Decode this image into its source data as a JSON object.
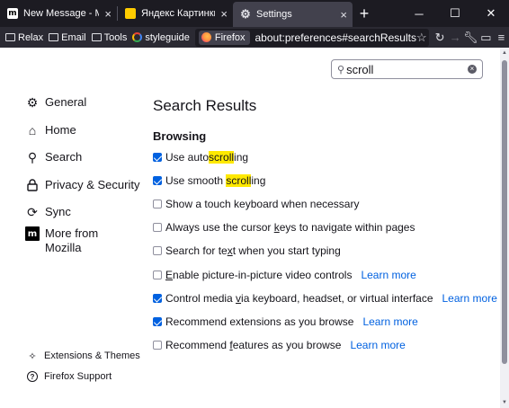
{
  "tabs": [
    {
      "label": "New Message - Mozilla C",
      "favicon": "mozilla-m-icon",
      "active": false
    },
    {
      "label": "Яндекс Картинки: поис",
      "favicon": "yandex-icon",
      "active": false
    },
    {
      "label": "Settings",
      "favicon": "gear-icon",
      "active": true
    }
  ],
  "bookmarks": [
    {
      "label": "Relax",
      "icon": "folder-icon"
    },
    {
      "label": "Email",
      "icon": "folder-icon"
    },
    {
      "label": "Tools",
      "icon": "folder-icon"
    },
    {
      "label": "styleguide",
      "icon": "google-icon"
    }
  ],
  "urlbar": {
    "identity": "Firefox",
    "url": "about:preferences#searchResults"
  },
  "search": {
    "value": "scroll"
  },
  "sidebar": {
    "items": [
      {
        "label": "General",
        "icon": "gear-icon"
      },
      {
        "label": "Home",
        "icon": "home-icon"
      },
      {
        "label": "Search",
        "icon": "search-icon"
      },
      {
        "label": "Privacy & Security",
        "icon": "lock-icon"
      },
      {
        "label": "Sync",
        "icon": "sync-icon"
      },
      {
        "label_line1": "More from",
        "label_line2": "Mozilla",
        "icon": "mozilla-m-icon"
      }
    ],
    "footer": [
      {
        "label": "Extensions & Themes",
        "icon": "puzzle-icon"
      },
      {
        "label": "Firefox Support",
        "icon": "help-icon"
      }
    ]
  },
  "main": {
    "title": "Search Results",
    "group": "Browsing",
    "learn_more": "Learn more",
    "options": {
      "autoscroll": {
        "before": "Use auto",
        "match": "scroll",
        "after": "ing",
        "checked": true
      },
      "smooth": {
        "before": "Use smooth ",
        "match": "scroll",
        "after": "ing",
        "checked": true
      },
      "touch": {
        "label": "Show a touch keyboard when necessary",
        "checked": false
      },
      "cursor": {
        "before": "Always use the cursor ",
        "underline": "k",
        "after": "eys to navigate within pages",
        "checked": false
      },
      "findtext": {
        "before": "Search for te",
        "underline": "x",
        "after": "t when you start typing",
        "checked": false
      },
      "pip": {
        "underline": "E",
        "after": "nable picture-in-picture video controls",
        "checked": false
      },
      "media": {
        "before": "Control media ",
        "underline": "v",
        "after": "ia keyboard, headset, or virtual interface",
        "checked": true
      },
      "ext": {
        "before": "Recommend extensions as you browse",
        "checked": true
      },
      "feat": {
        "before": "Recommend ",
        "underline": "f",
        "after": "eatures as you browse",
        "checked": false
      }
    }
  },
  "colors": {
    "accent": "#0061e0",
    "highlight": "#ffe900",
    "chrome_dark": "#1c1b22"
  }
}
